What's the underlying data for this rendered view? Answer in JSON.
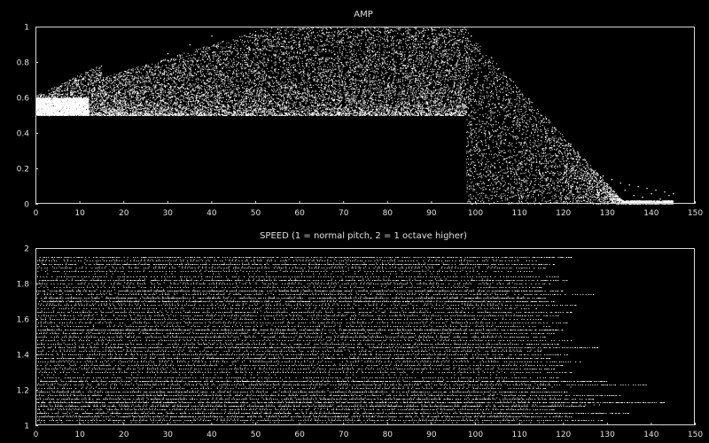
{
  "chart_data": [
    {
      "type": "scatter",
      "title": "AMP",
      "xlim": [
        0,
        150
      ],
      "ylim": [
        0,
        1
      ],
      "xticks": [
        "0",
        "10",
        "20",
        "30",
        "40",
        "50",
        "60",
        "70",
        "80",
        "90",
        "100",
        "110",
        "120",
        "130",
        "140",
        "150"
      ],
      "yticks": [
        "0",
        "0.2",
        "0.4",
        "0.6",
        "0.8",
        "1"
      ],
      "point_color": "#ffffff",
      "grid": false,
      "series": [
        {
          "x": [
            0.5,
            1,
            1.5,
            2,
            3,
            4,
            5,
            6,
            8,
            10,
            12,
            15,
            18,
            20,
            22,
            25,
            28,
            30,
            33,
            35,
            38,
            40,
            43,
            45,
            48,
            50,
            53,
            55,
            58,
            60,
            63,
            65,
            68,
            70,
            73,
            75,
            78,
            80,
            83,
            85,
            88,
            90,
            92,
            95,
            97,
            99,
            1,
            2,
            3,
            5,
            7,
            9,
            11,
            14,
            17,
            21,
            24,
            27,
            31,
            34,
            37,
            41,
            44,
            47,
            51,
            54,
            57,
            61,
            64,
            67,
            71,
            74,
            77,
            81,
            84,
            87,
            91,
            94,
            96,
            98,
            101,
            102,
            103,
            104,
            105,
            106,
            107,
            108,
            109,
            110,
            111,
            112,
            113,
            114,
            115,
            116,
            117,
            118,
            119,
            120,
            121,
            122,
            123,
            124,
            125,
            126,
            127,
            128,
            129,
            130,
            131,
            132,
            133,
            134,
            135,
            136,
            137,
            138,
            139,
            140,
            141,
            142,
            143,
            144,
            145
          ],
          "y": [
            0.52,
            0.55,
            0.53,
            0.58,
            0.54,
            0.6,
            0.56,
            0.62,
            0.57,
            0.65,
            0.59,
            0.7,
            0.6,
            0.72,
            0.63,
            0.78,
            0.61,
            0.85,
            0.66,
            0.9,
            0.62,
            0.95,
            0.7,
            0.88,
            0.64,
            0.93,
            0.72,
            0.97,
            0.6,
            0.99,
            0.75,
            0.92,
            0.68,
            0.96,
            0.8,
            0.9,
            0.7,
            0.98,
            0.82,
            0.94,
            0.76,
            0.99,
            0.85,
            0.97,
            0.92,
            0.95,
            0.51,
            0.52,
            0.5,
            0.53,
            0.51,
            0.54,
            0.52,
            0.55,
            0.53,
            0.56,
            0.52,
            0.57,
            0.54,
            0.53,
            0.58,
            0.55,
            0.52,
            0.56,
            0.54,
            0.53,
            0.57,
            0.55,
            0.52,
            0.56,
            0.54,
            0.53,
            0.55,
            0.57,
            0.52,
            0.54,
            0.56,
            0.53,
            0.55,
            0.52,
            0.85,
            0.6,
            0.78,
            0.45,
            0.7,
            0.3,
            0.62,
            0.2,
            0.55,
            0.12,
            0.5,
            0.25,
            0.44,
            0.08,
            0.38,
            0.18,
            0.32,
            0.05,
            0.3,
            0.15,
            0.26,
            0.1,
            0.22,
            0.04,
            0.2,
            0.12,
            0.18,
            0.06,
            0.16,
            0.1,
            0.14,
            0.03,
            0.12,
            0.08,
            0.11,
            0.05,
            0.1,
            0.04,
            0.09,
            0.06,
            0.08,
            0.03,
            0.07,
            0.05,
            0.06
          ]
        }
      ]
    },
    {
      "type": "scatter",
      "title": "SPEED (1 = normal pitch, 2 = 1 octave higher)",
      "xlim": [
        0,
        150
      ],
      "ylim": [
        1,
        2
      ],
      "xticks": [
        "0",
        "10",
        "20",
        "30",
        "40",
        "50",
        "60",
        "70",
        "80",
        "90",
        "100",
        "110",
        "120",
        "130",
        "140",
        "150"
      ],
      "yticks": [
        "1",
        "1.2",
        "1.4",
        "1.6",
        "1.8",
        "2"
      ],
      "point_color": "#ffffff",
      "grid": false,
      "series": [
        {
          "pitch_levels": [
            1.95,
            1.93,
            1.91,
            1.89,
            1.87,
            1.84,
            1.82,
            1.8,
            1.78,
            1.76,
            1.74,
            1.72,
            1.7,
            1.68,
            1.66,
            1.64,
            1.62,
            1.6,
            1.58,
            1.56,
            1.54,
            1.52,
            1.5,
            1.48,
            1.46,
            1.44,
            1.42,
            1.4,
            1.38,
            1.36,
            1.34,
            1.32,
            1.3,
            1.27,
            1.25,
            1.23,
            1.21,
            1.19,
            1.17,
            1.15,
            1.13,
            1.11,
            1.09,
            1.07,
            1.05,
            1.03
          ],
          "end_x": [
            122,
            114,
            118,
            116,
            113,
            119,
            121,
            117,
            115,
            120,
            127,
            116,
            118,
            123,
            114,
            122,
            119,
            115,
            121,
            117,
            120,
            118,
            116,
            122,
            119,
            128,
            115,
            121,
            117,
            124,
            120,
            118,
            122,
            119,
            130,
            139,
            116,
            121,
            133,
            127,
            143,
            125,
            118,
            135,
            122,
            129
          ]
        }
      ]
    }
  ]
}
